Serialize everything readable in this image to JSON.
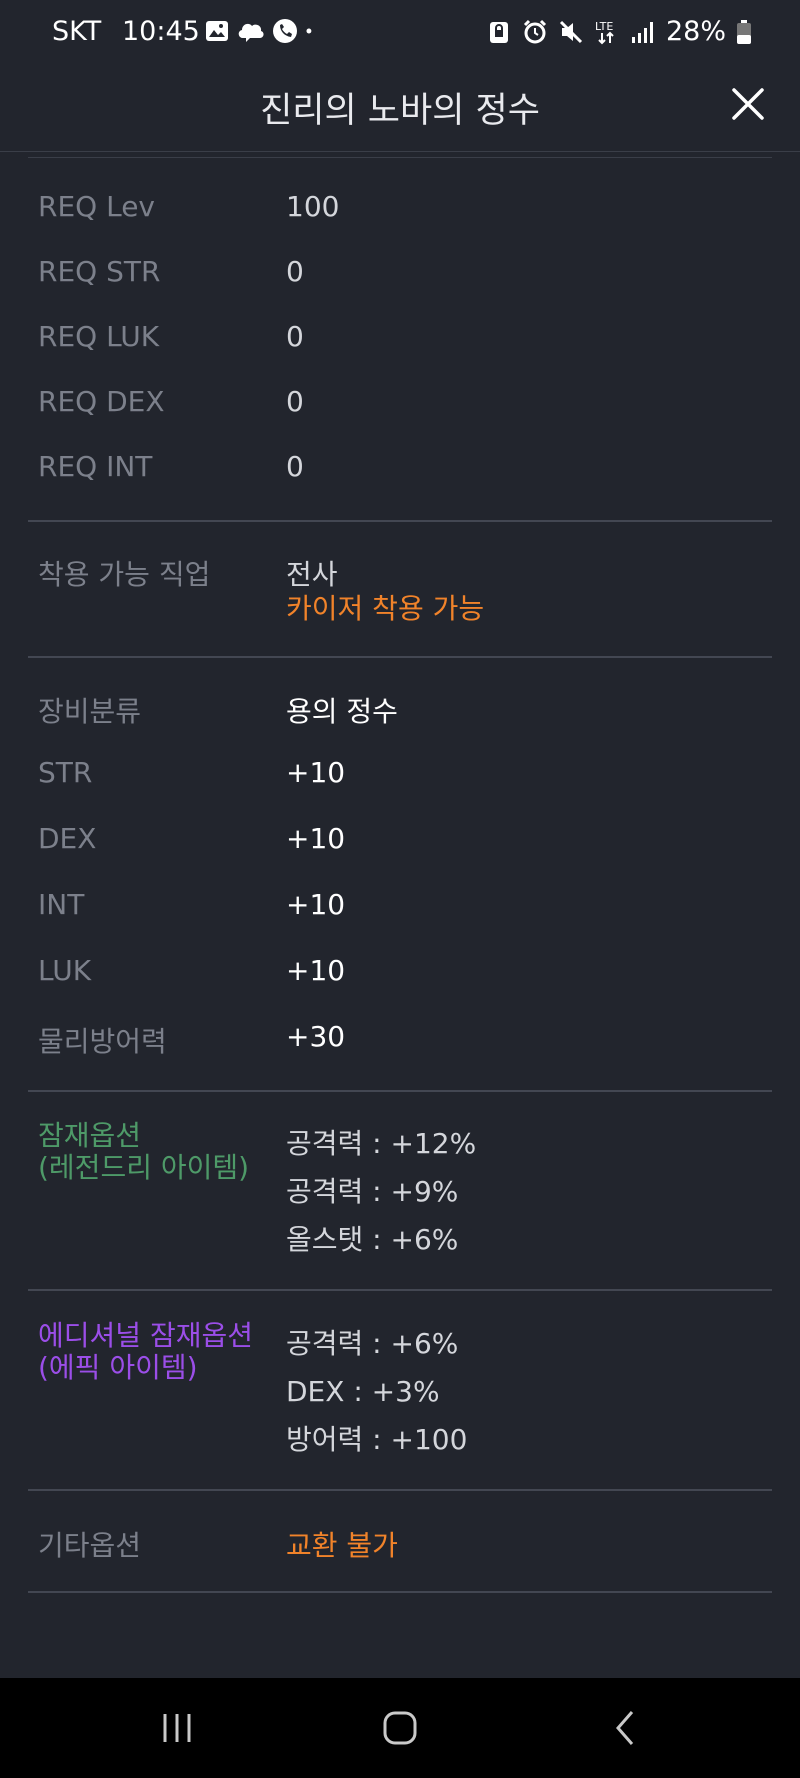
{
  "status_bar": {
    "carrier": "SKT",
    "time": "10:45",
    "battery": "28%",
    "notification_icons": [
      "image-icon",
      "cloud-icon",
      "phone-icon",
      "dot-icon"
    ],
    "system_icons": [
      "lock-icon",
      "alarm-icon",
      "mute-icon",
      "lte-icon",
      "signal-icon",
      "battery-icon"
    ]
  },
  "header": {
    "title": "진리의 노바의 정수",
    "close_icon": "close-icon"
  },
  "requirements": [
    {
      "label": "REQ Lev",
      "value": "100"
    },
    {
      "label": "REQ STR",
      "value": "0"
    },
    {
      "label": "REQ LUK",
      "value": "0"
    },
    {
      "label": "REQ DEX",
      "value": "0"
    },
    {
      "label": "REQ INT",
      "value": "0"
    }
  ],
  "job": {
    "label": "착용 가능 직업",
    "value": "전사",
    "note": "카이저 착용 가능"
  },
  "stats": [
    {
      "label": "장비분류",
      "value": "용의 정수"
    },
    {
      "label": "STR",
      "value": "+10"
    },
    {
      "label": "DEX",
      "value": "+10"
    },
    {
      "label": "INT",
      "value": "+10"
    },
    {
      "label": "LUK",
      "value": "+10"
    },
    {
      "label": "물리방어력",
      "value": "+30"
    }
  ],
  "potential": {
    "label_line1": "잠재옵션",
    "label_line2": "(레전드리 아이템)",
    "values": [
      "공격력 : +12%",
      "공격력 : +9%",
      "올스탯 : +6%"
    ]
  },
  "additional_potential": {
    "label_line1": "에디셔널 잠재옵션",
    "label_line2": "(에픽 아이템)",
    "values": [
      "공격력 : +6%",
      "DEX : +3%",
      "방어력 : +100"
    ]
  },
  "other": {
    "label": "기타옵션",
    "value": "교환 불가"
  },
  "nav": {
    "recent_icon": "recent-apps-icon",
    "home_icon": "home-icon",
    "back_icon": "back-icon"
  },
  "colors": {
    "background": "#22252d",
    "label": "#7c808b",
    "value": "#d4d6db",
    "orange": "#f1832a",
    "green": "#4e9a68",
    "purple": "#9b4ee8"
  }
}
